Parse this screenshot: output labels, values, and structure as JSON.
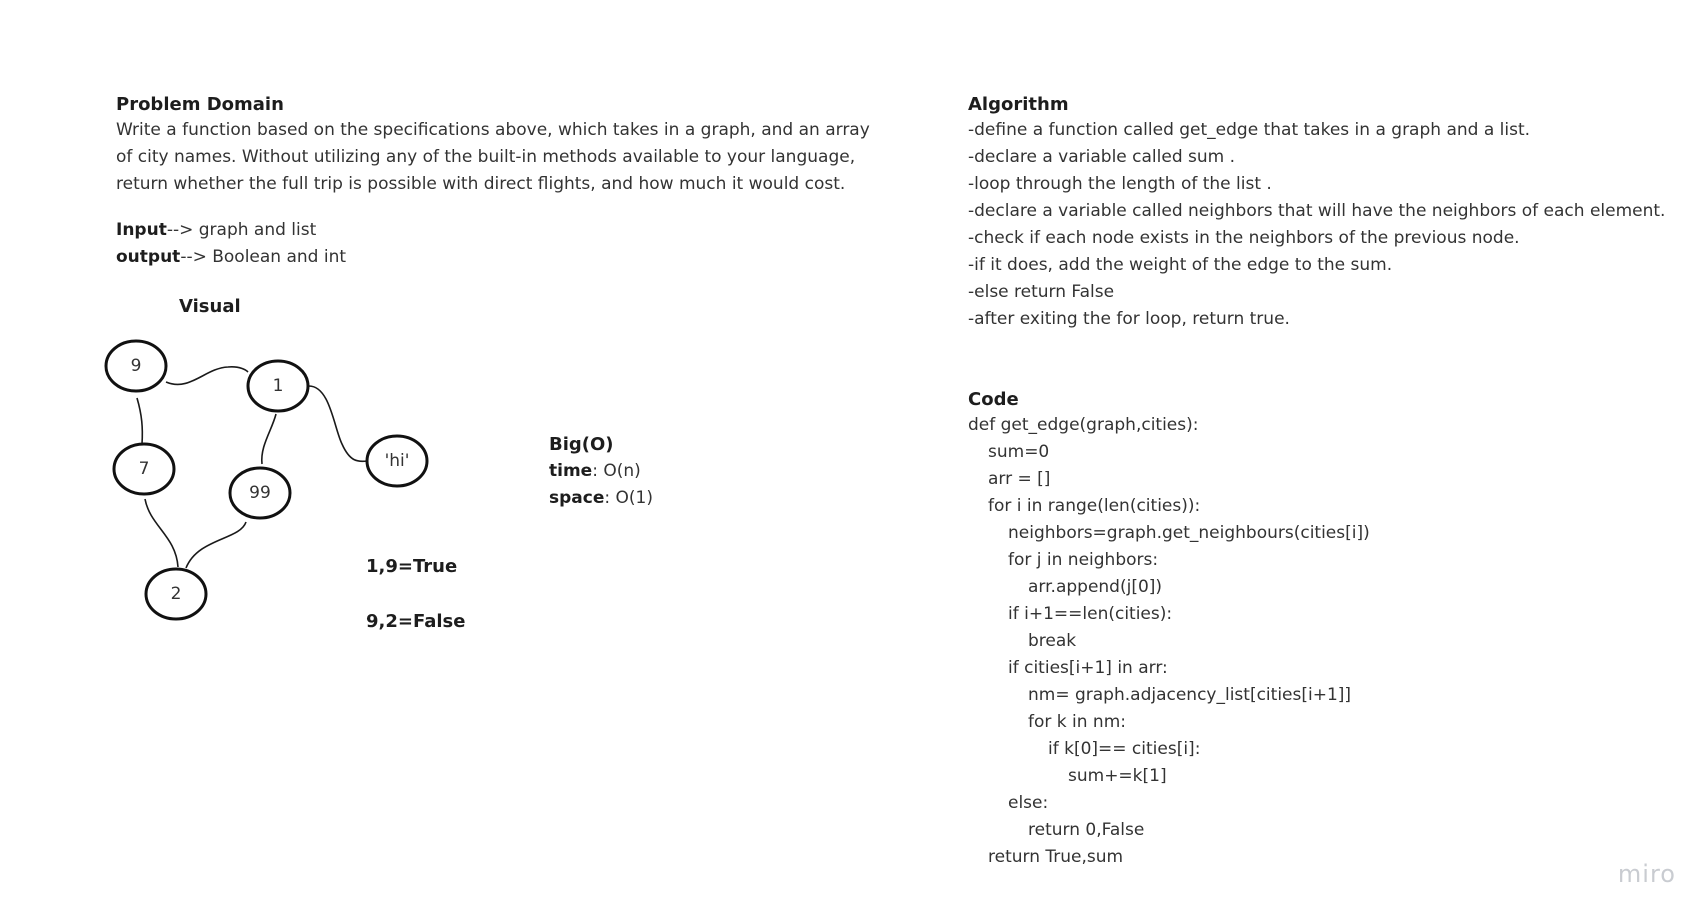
{
  "problem": {
    "title": "Problem Domain",
    "description_lines": [
      "Write a function based on the specifications above, which takes in a graph, and an array",
      "of city names. Without utilizing any of the built-in methods available to your language,",
      "return whether the full trip is possible with direct flights, and how much it would cost."
    ],
    "input_label": "Input",
    "input_text": "--> graph and list",
    "output_label": "output",
    "output_text": "--> Boolean and int"
  },
  "visual": {
    "title": "Visual",
    "nodes": {
      "n9": "9",
      "n1": "1",
      "nhi": "'hi'",
      "n7": "7",
      "n99": "99",
      "n2": "2"
    },
    "examples": [
      "1,9=True",
      "9,2=False"
    ]
  },
  "bigo": {
    "title": "Big(O)",
    "time_label": "time",
    "time_value": ": O(n)",
    "space_label": "space",
    "space_value": ": O(1)"
  },
  "algorithm": {
    "title": "Algorithm",
    "steps": [
      "-define a function called get_edge that takes in a graph and a list.",
      "-declare a variable called sum .",
      "-loop through the length of the list .",
      "-declare a variable called neighbors that will have the neighbors of each element.",
      "-check if each node exists in the neighbors of the previous node.",
      "-if it does, add the weight of the edge to the sum.",
      "-else return False",
      "-after exiting the for loop, return true."
    ]
  },
  "code": {
    "title": "Code",
    "lines": [
      "def get_edge(graph,cities):",
      "sum=0",
      "arr = []",
      "for i in range(len(cities)):",
      "neighbors=graph.get_neighbours(cities[i])",
      "for j in neighbors:",
      "arr.append(j[0])",
      "if i+1==len(cities):",
      "break",
      "if cities[i+1] in arr:",
      "nm= graph.adjacency_list[cities[i+1]]",
      "for k in nm:",
      "if k[0]== cities[i]:",
      "sum+=k[1]",
      "else:",
      "return 0,False",
      "return True,sum"
    ]
  },
  "watermark": "miro"
}
